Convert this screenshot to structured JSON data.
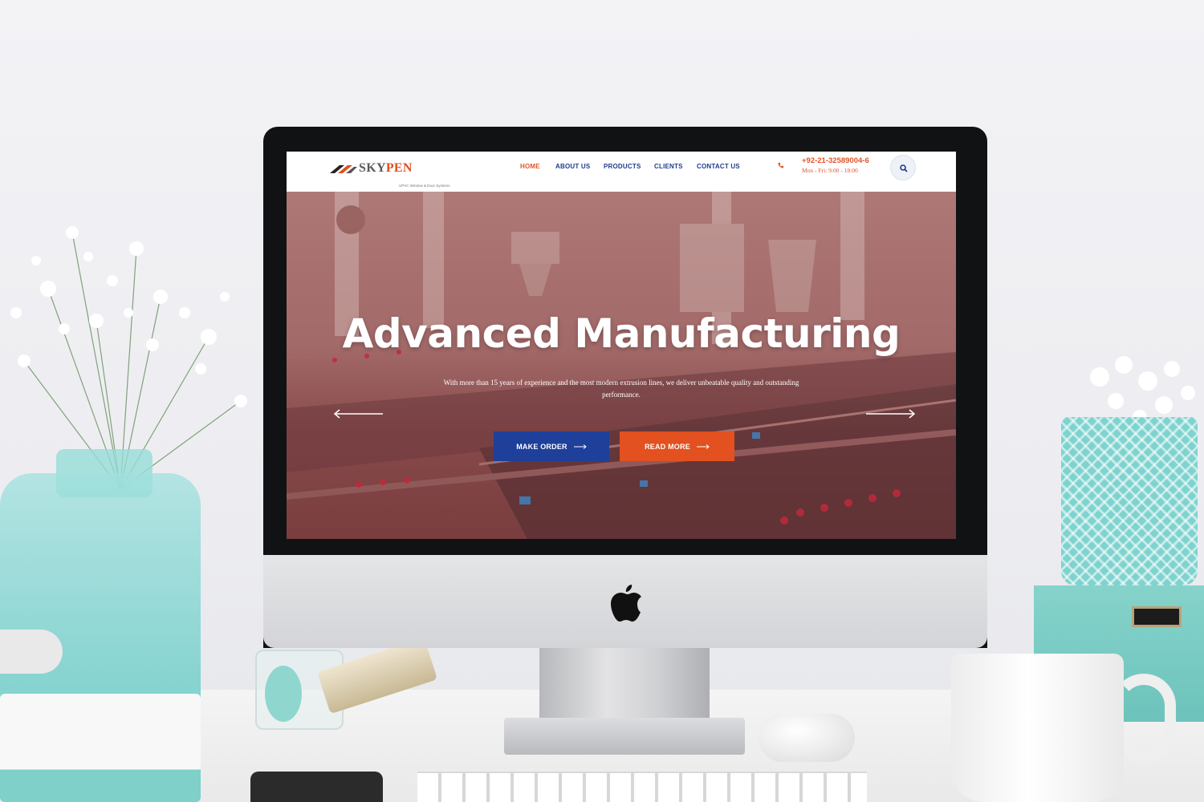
{
  "site": {
    "logo": {
      "brand_part1": "SKY",
      "brand_part2": "PEN",
      "tagline": "UPVC Window & Door Systems"
    },
    "nav": [
      {
        "label": "HOME",
        "active": true
      },
      {
        "label": "ABOUT US",
        "active": false
      },
      {
        "label": "PRODUCTS",
        "active": false
      },
      {
        "label": "CLIENTS",
        "active": false
      },
      {
        "label": "CONTACT US",
        "active": false
      }
    ],
    "contact": {
      "phone": "+92-21-32589004-6",
      "hours": "Mon - Fri: 9:00 - 18:00",
      "icon": "phone-icon"
    },
    "search_icon": "search-icon"
  },
  "hero": {
    "title": "Advanced Manufacturing",
    "subtitle": "With more than 15 years of experience and the most modern extrusion lines, we deliver unbeatable quality and outstanding performance.",
    "prev_icon": "arrow-left-icon",
    "next_icon": "arrow-right-icon",
    "buttons": {
      "make_order": "MAKE ORDER",
      "read_more": "READ MORE"
    }
  },
  "colors": {
    "accent_orange": "#e2511f",
    "accent_blue": "#1e3f9a",
    "nav_text": "#1f3d8c",
    "hero_overlay": "#96504f"
  }
}
